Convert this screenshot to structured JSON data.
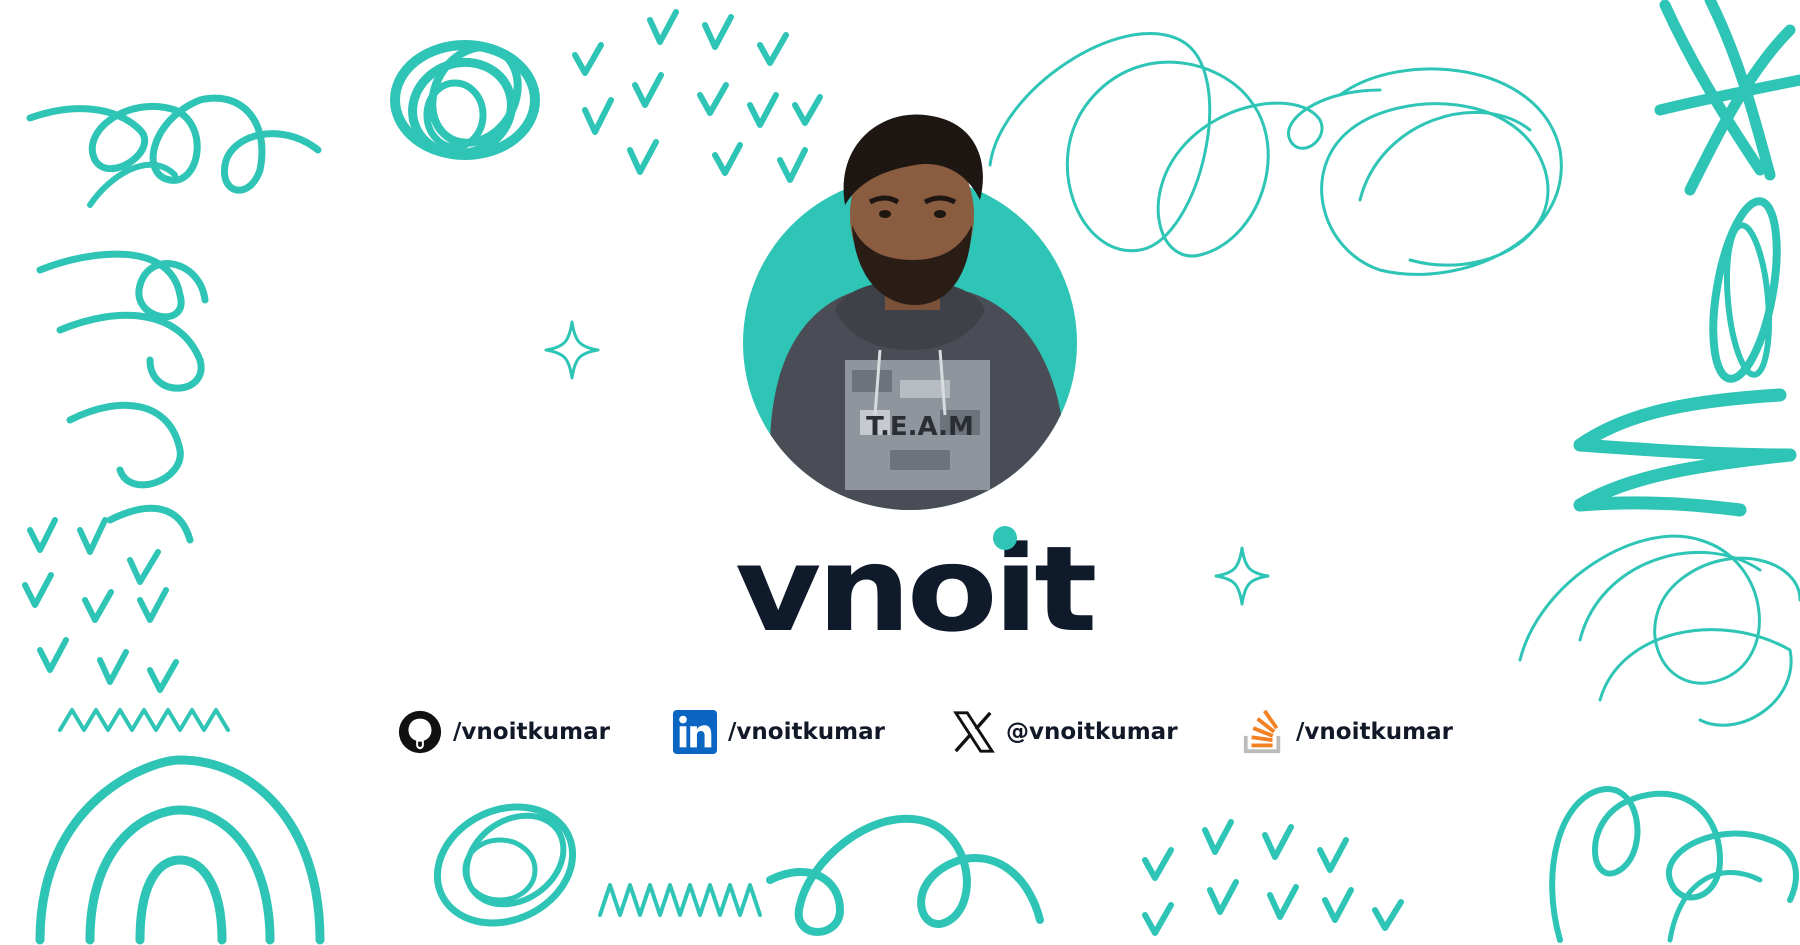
{
  "brand": {
    "logo_text": "vnoit"
  },
  "profile": {
    "shirt_print": "T.E.A.M"
  },
  "colors": {
    "accent": "#2ec4b6",
    "ink": "#0f1a2b",
    "background": "#ffffff",
    "linkedin_blue": "#0a66c2",
    "stackoverflow_orange": "#f48024"
  },
  "socials": [
    {
      "icon": "github-icon",
      "handle": "/vnoitkumar"
    },
    {
      "icon": "linkedin-icon",
      "handle": "/vnoitkumar"
    },
    {
      "icon": "x-icon",
      "handle": "@vnoitkumar"
    },
    {
      "icon": "stackoverflow-icon",
      "handle": "/vnoitkumar"
    }
  ]
}
